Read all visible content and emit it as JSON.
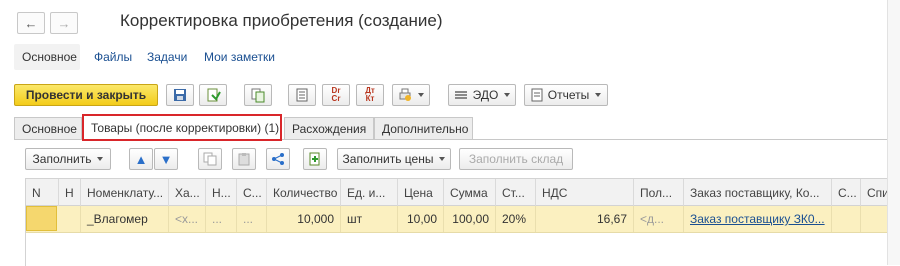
{
  "window": {
    "title": "Корректировка приобретения (создание)"
  },
  "sections": {
    "main": "Основное",
    "files": "Файлы",
    "tasks": "Задачи",
    "notes": "Мои заметки"
  },
  "toolbar": {
    "post_close": "Провести и закрыть",
    "dt_kt_label1": "Dr Cr",
    "dt_kt_label2": "Дт Кт",
    "edo": "ЭДО",
    "reports": "Отчеты"
  },
  "tabs": [
    {
      "label": "Основное"
    },
    {
      "label": "Товары (после корректировки) (1)"
    },
    {
      "label": "Расхождения"
    },
    {
      "label": "Дополнительно"
    }
  ],
  "table_toolbar": {
    "fill": "Заполнить",
    "fill_prices": "Заполнить цены",
    "fill_warehouse": "Заполнить склад"
  },
  "table": {
    "headers": [
      "N",
      "Н",
      "Номенклату...",
      "Ха...",
      "Н...",
      "С...",
      "Количество",
      "Ед. и...",
      "Цена",
      "Сумма",
      "Ст...",
      "НДС",
      "Пол...",
      "Заказ поставщику, Ко...",
      "С...",
      "Спи"
    ],
    "rows": [
      {
        "n": "",
        "h": "",
        "nomenclature": "_Влагомер",
        "characteristic": "<х...",
        "n2": "...",
        "s": "...",
        "quantity": "10,000",
        "unit": "шт",
        "price": "10,00",
        "sum": "100,00",
        "rate": "20%",
        "vat": "16,67",
        "recipient": "<д...",
        "order": "Заказ поставщику ЗК0...",
        "c": "",
        "spi": ""
      }
    ]
  },
  "colors": {
    "accent_yellow": "#f3cc1a",
    "active_tab_border": "#d9262a",
    "row_highlight": "#fbf0c0",
    "link": "#1a4f91"
  }
}
